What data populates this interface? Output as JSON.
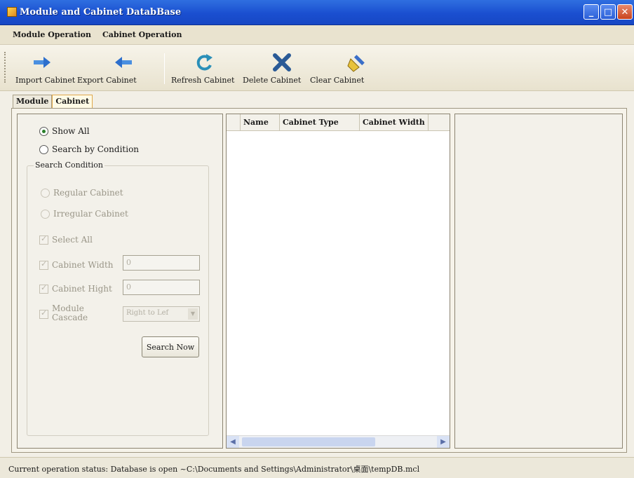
{
  "window": {
    "title": "Module and Cabinet DatabBase"
  },
  "menu": {
    "items": [
      "Module Operation",
      "Cabinet Operation"
    ]
  },
  "toolbar": {
    "buttons": [
      {
        "label": "Import Cabinet",
        "icon": "arrow-right-icon"
      },
      {
        "label": "Export Cabinet",
        "icon": "arrow-left-icon"
      },
      {
        "label": "Refresh Cabinet",
        "icon": "refresh-icon"
      },
      {
        "label": "Delete Cabinet",
        "icon": "delete-x-icon"
      },
      {
        "label": "Clear Cabinet",
        "icon": "broom-icon"
      }
    ]
  },
  "tabs": [
    {
      "label": "Module",
      "active": false
    },
    {
      "label": "Cabinet",
      "active": true
    }
  ],
  "filter": {
    "show_all": "Show All",
    "search_by_condition": "Search by Condition",
    "search_condition_legend": "Search Condition",
    "regular_cabinet": "Regular Cabinet",
    "irregular_cabinet": "Irregular Cabinet",
    "select_all": "Select All",
    "cabinet_width_label": "Cabinet Width",
    "cabinet_width_value": "0",
    "cabinet_hight_label": "Cabinet Hight",
    "cabinet_hight_value": "0",
    "module_cascade_label": "Module Cascade",
    "module_cascade_value": "Right to Lef",
    "search_button": "Search Now"
  },
  "grid": {
    "columns": [
      "Name",
      "Cabinet Type",
      "Cabinet Width"
    ]
  },
  "status": {
    "text": "Current operation status: Database is open ~C:\\Documents and Settings\\Administrator\\桌面\\tempDB.mcl"
  },
  "colors": {
    "title_bar": "#1a4fd0",
    "window_bg": "#f2efe6",
    "accent_tab": "#e0a84b"
  }
}
